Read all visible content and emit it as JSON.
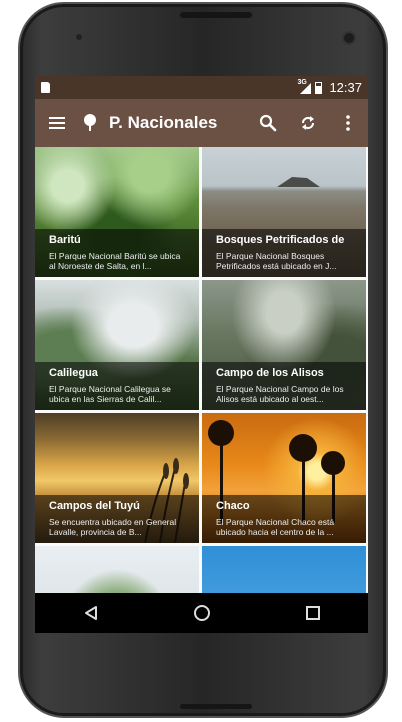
{
  "status_bar": {
    "network": "3G",
    "time": "12:37"
  },
  "toolbar": {
    "title": "P. Nacionales",
    "icons": [
      "menu-icon",
      "tree-icon",
      "search-icon",
      "refresh-icon",
      "overflow-icon"
    ]
  },
  "parks": [
    {
      "name": "Baritú",
      "description": "El Parque Nacional Baritú se ubica al Noroeste de Salta, en l..."
    },
    {
      "name": "Bosques Petrificados de",
      "description": "El Parque Nacional Bosques Petrificados está ubicado en J..."
    },
    {
      "name": "Calilegua",
      "description": "El Parque Nacional Calilegua se ubica en las Sierras de Calil..."
    },
    {
      "name": "Campo de los Alisos",
      "description": "El Parque Nacional Campo de los Alisos está ubicado al oest..."
    },
    {
      "name": "Campos del Tuyú",
      "description": "Se encuentra ubicado en General Lavalle, provincia de B..."
    },
    {
      "name": "Chaco",
      "description": "El Parque Nacional Chaco está ubicado hacia el centro de la ..."
    }
  ],
  "navbar": {
    "icons": [
      "back-icon",
      "home-icon",
      "recents-icon"
    ]
  },
  "colors": {
    "toolbar": "#6b5044",
    "status_bar": "#4a3529"
  }
}
